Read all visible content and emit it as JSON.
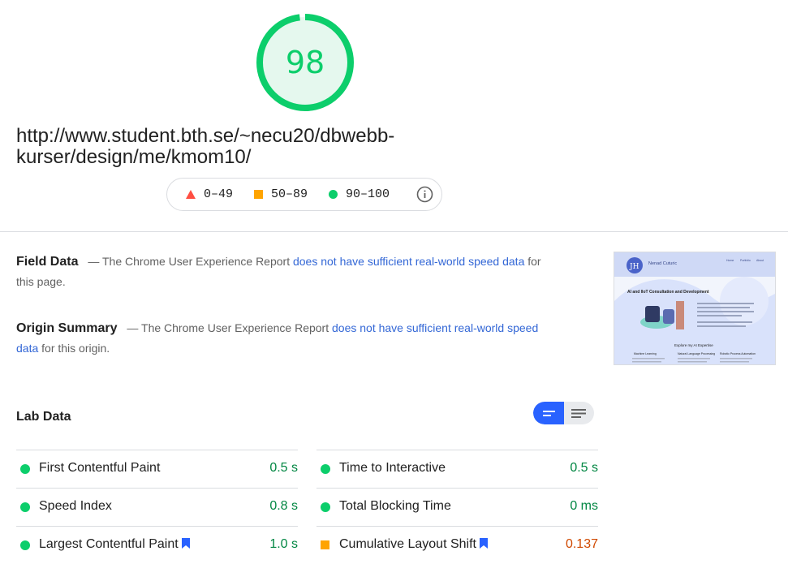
{
  "score": {
    "value": "98",
    "ring_fraction": 0.98,
    "color": "#0cce6b",
    "fill": "#e5f8ee"
  },
  "url": "http://www.student.bth.se/~necu20/dbwebb-kurser/design/me/kmom10/",
  "legend": {
    "fail": "0–49",
    "average": "50–89",
    "pass": "90–100",
    "fail_color": "#ff4e42",
    "average_color": "#ffa400",
    "pass_color": "#0cce6b"
  },
  "field_data": {
    "title": "Field Data",
    "text_before": "— The Chrome User Experience Report ",
    "link": "does not have sufficient real-world speed data",
    "text_after": " for this page."
  },
  "origin_summary": {
    "title": "Origin Summary",
    "text_before": "— The Chrome User Experience Report ",
    "link": "does not have sufficient real-world speed data",
    "text_after": " for this origin."
  },
  "thumbnail": {
    "site_name": "Nenad Cuturic",
    "heading": "AI and IIoT Consultation and Development",
    "section_heading": "Explore my AI Expertise",
    "nav": [
      "Home",
      "Portfolio",
      "About"
    ],
    "columns": [
      "Machine Learning",
      "Natural Language Processing",
      "Robotic Process Automation"
    ]
  },
  "lab_data": {
    "title": "Lab Data",
    "metrics_left": [
      {
        "name": "First Contentful Paint",
        "value": "0.5 s",
        "status": "pass",
        "new": false
      },
      {
        "name": "Speed Index",
        "value": "0.8 s",
        "status": "pass",
        "new": false
      },
      {
        "name": "Largest Contentful Paint",
        "value": "1.0 s",
        "status": "pass",
        "new": true
      }
    ],
    "metrics_right": [
      {
        "name": "Time to Interactive",
        "value": "0.5 s",
        "status": "pass",
        "new": false
      },
      {
        "name": "Total Blocking Time",
        "value": "0 ms",
        "status": "pass",
        "new": false
      },
      {
        "name": "Cumulative Layout Shift",
        "value": "0.137",
        "status": "average",
        "new": true
      }
    ]
  },
  "icons": {
    "info": "info-icon",
    "bookmark": "bookmark-icon",
    "toggle_compact": "view-compact-icon",
    "toggle_expanded": "view-expanded-icon"
  }
}
